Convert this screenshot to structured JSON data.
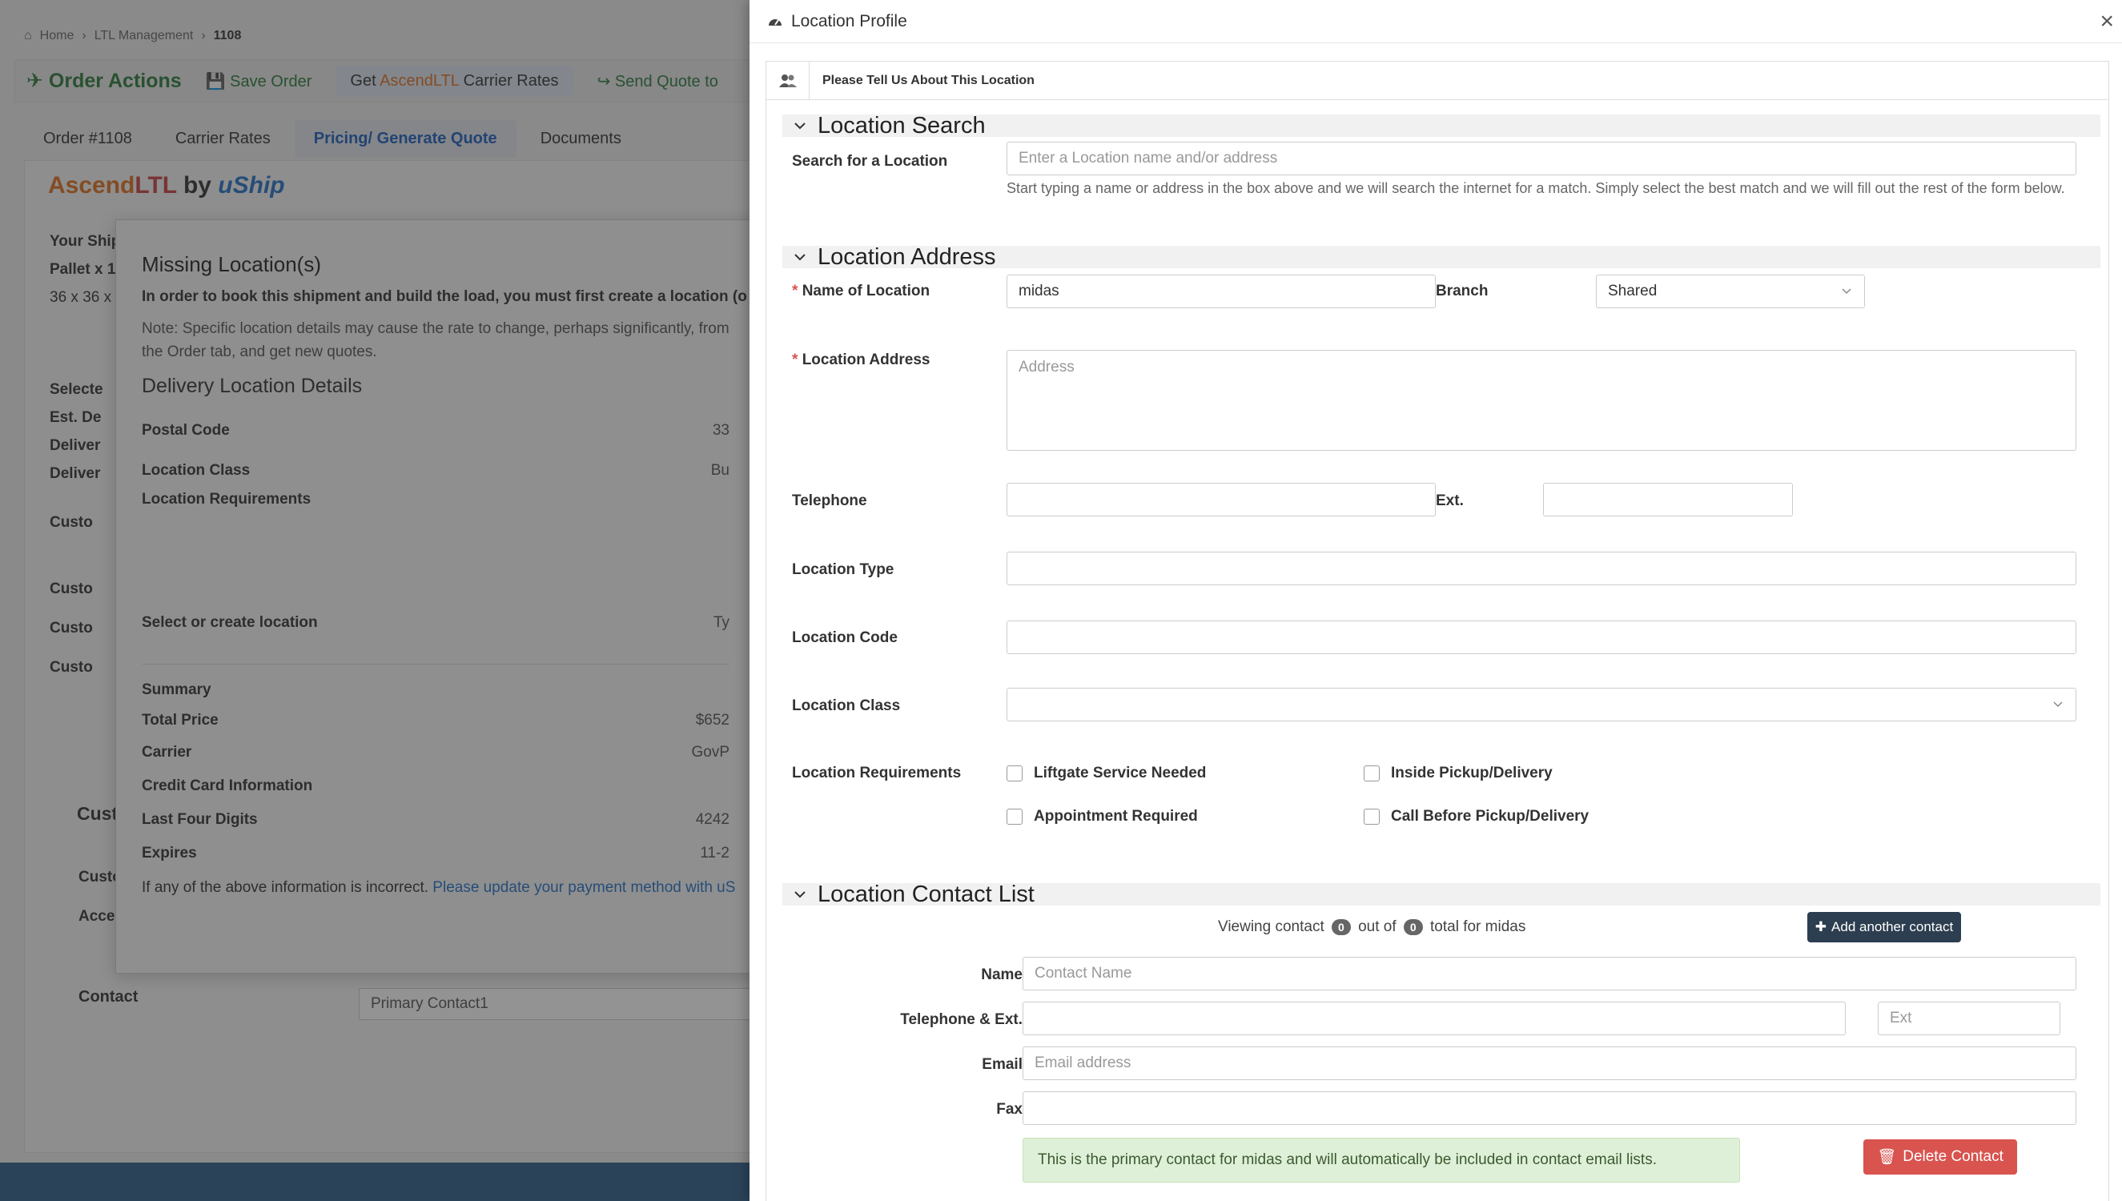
{
  "background": {
    "breadcrumbs": [
      "Home",
      "LTL Management",
      "1108"
    ],
    "order_actions": "Order Actions",
    "save_order": "Save Order",
    "get_rates_prefix": "Get",
    "get_rates_brand": "AscendLTL",
    "get_rates_suffix": "Carrier Rates",
    "send_quote": "Send Quote to",
    "tabs": [
      "Order #1108",
      "Carrier Rates",
      "Pricing/ Generate Quote",
      "Documents"
    ],
    "brand_ascend": "Ascend",
    "brand_ltl": "LTL",
    "brand_by": "by",
    "brand_uship": "uShip",
    "left_labels": [
      "Your Ship",
      "Pallet x 1",
      "36 x 36 x",
      "Selecte",
      "Est. De",
      "Deliver",
      "Deliver",
      "Custo",
      "Custo",
      "Custo",
      "Custo",
      "Cust",
      "Custo",
      "Acce"
    ],
    "contact_label": "Contact",
    "contact_value": "Primary Contact1"
  },
  "modal": {
    "title": "Missing Location(s)",
    "bold_text": "In order to book this shipment and build the load, you must first create a location (o",
    "note": "Note: Specific location details may cause the rate to change, perhaps significantly, from",
    "note2": "the Order tab, and get new quotes.",
    "section": "Delivery Location Details",
    "rows": [
      {
        "label": "Postal Code",
        "value": "33"
      },
      {
        "label": "Location Class",
        "value": "Bu"
      },
      {
        "label": "Location Requirements",
        "value": ""
      },
      {
        "label": "Select or create location",
        "value": "Ty"
      }
    ],
    "summary_title": "Summary",
    "summary": [
      {
        "label": "Total Price",
        "value": "$652"
      },
      {
        "label": "Carrier",
        "value": "GovP"
      }
    ],
    "cc_title": "Credit Card Information",
    "cc": [
      {
        "label": "Last Four Digits",
        "value": "4242"
      },
      {
        "label": "Expires",
        "value": "11-2"
      }
    ],
    "footer_text": "If any of the above information is incorrect.",
    "footer_link": "Please update your payment method with uS"
  },
  "drawer": {
    "title": "Location Profile",
    "close": "×",
    "card_title": "Please Tell Us About This Location",
    "search_section": "Location Search",
    "search_label": "Search for a Location",
    "search_placeholder": "Enter a Location name and/or address",
    "search_help": "Start typing a name or address in the box above and we will search the internet for a match. Simply select the best match and we will fill out the rest of the form below.",
    "address_section": "Location Address",
    "name_label": "Name of Location",
    "name_value": "midas",
    "branch_label": "Branch",
    "branch_value": "Shared",
    "address_label": "Location Address",
    "address_placeholder": "Address",
    "telephone_label": "Telephone",
    "ext_label": "Ext.",
    "type_label": "Location Type",
    "code_label": "Location Code",
    "class_label": "Location Class",
    "requirements_label": "Location Requirements",
    "requirements": [
      "Liftgate Service Needed",
      "Inside Pickup/Delivery",
      "Appointment Required",
      "Call Before Pickup/Delivery"
    ],
    "contact_section": "Location Contact List",
    "viewing_prefix": "Viewing contact",
    "viewing_current": "0",
    "viewing_mid": "out of",
    "viewing_total": "0",
    "viewing_suffix": "total for midas",
    "add_contact": "Add another contact",
    "contact_name_label": "Name",
    "contact_name_placeholder": "Contact Name",
    "contact_tel_label": "Telephone & Ext.",
    "contact_ext_placeholder": "Ext",
    "contact_email_label": "Email",
    "contact_email_placeholder": "Email address",
    "contact_fax_label": "Fax",
    "primary_note": "This is the primary contact for midas and will automatically be included in contact email lists.",
    "delete_contact": "Delete Contact"
  }
}
